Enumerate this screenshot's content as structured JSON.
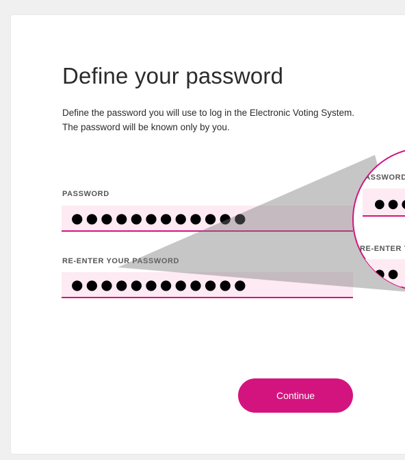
{
  "page": {
    "title": "Define your password",
    "description": "Define the password you will use to log in the Electronic Voting System. The password will be known only by you."
  },
  "password": {
    "label": "PASSWORD",
    "value": "●●●●●●●●●●●●"
  },
  "reenter": {
    "label": "RE-ENTER YOUR PASSWORD",
    "value": "●●●●●●●●●●●●"
  },
  "continue_label": "Continue",
  "zoom": {
    "password_label": "PASSWORD",
    "reenter_label": "RE-ENTER YOUR PASSWORD",
    "password_value": "●●●",
    "reenter_value": "●●"
  },
  "colors": {
    "accent": "#d4147e",
    "field_bg": "#fdeaf3",
    "page_bg": "#f0f0f0",
    "card_bg": "#ffffff"
  }
}
